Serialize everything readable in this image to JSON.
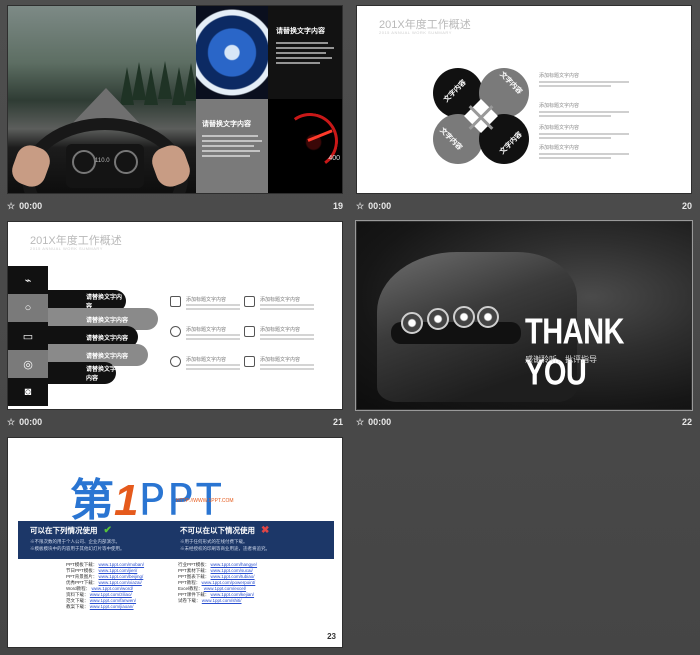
{
  "slides": [
    {
      "number": "19",
      "time": "00:00",
      "panel_top_title": "请替换文字内容",
      "panel_bottom_title": "请替换文字内容",
      "speedometer_value": "400",
      "dash_value": "110.0"
    },
    {
      "number": "20",
      "time": "00:00",
      "title": "201X年度工作概述",
      "subtitle": "2015 ANNUAL WORK SUMMARY",
      "labels": [
        "文字内容",
        "文字内容",
        "文字内容",
        "文字内容"
      ],
      "text_heads": [
        "添加标题文字内容",
        "添加标题文字内容",
        "添加标题文字内容",
        "添加标题文字内容"
      ]
    },
    {
      "number": "21",
      "time": "00:00",
      "title": "201X年度工作概述",
      "subtitle": "2015 ANNUAL WORK SUMMARY",
      "arms": [
        "请替换文字内容",
        "请替换文字内容",
        "请替换文字内容",
        "请替换文字内容",
        "请替换文字内容"
      ],
      "items": [
        "添加标题文字内容",
        "添加标题文字内容",
        "添加标题文字内容",
        "添加标题文字内容",
        "添加标题文字内容",
        "添加标题文字内容"
      ]
    },
    {
      "number": "22",
      "time": "00:00",
      "headline": "THANK YOU",
      "subline": "感谢聆听，批评指导"
    },
    {
      "number": "23",
      "logo_cn": "第",
      "logo_one": "1",
      "logo_ppt": "PPT",
      "logo_url": "HTTP://WWW.1PPT.COM",
      "can_title": "可以在下列情况使用",
      "cannot_title": "不可以在以下情况使用",
      "can_lines": [
        "※不限次数的用于个人公司、企业内部演示。",
        "※模板模块中的内容用于其他幻灯片等中使用。"
      ],
      "cannot_lines": [
        "※用于任何形式的在线付费下载。",
        "※未经授权的印刷等商业用途，违者将追究。"
      ],
      "left_links": [
        {
          "label": "PPT模板下载：",
          "url": "www.1ppt.com/moban/"
        },
        {
          "label": "节日PPT模板：",
          "url": "www.1ppt.com/jieri/"
        },
        {
          "label": "PPT背景图片：",
          "url": "www.1ppt.com/beijing/"
        },
        {
          "label": "优秀PPT下载：",
          "url": "www.1ppt.com/xiazai/"
        },
        {
          "label": "Word教程：",
          "url": "www.1ppt.com/word/"
        },
        {
          "label": "资料下载：",
          "url": "www.1ppt.com/ziliao/"
        },
        {
          "label": "范文下载：",
          "url": "www.1ppt.com/fanwen/"
        },
        {
          "label": "教案下载：",
          "url": "www.1ppt.com/jiaoan/"
        }
      ],
      "right_links": [
        {
          "label": "行业PPT模板：",
          "url": "www.1ppt.com/hangye/"
        },
        {
          "label": "PPT素材下载：",
          "url": "www.1ppt.com/sucai/"
        },
        {
          "label": "PPT图表下载：",
          "url": "www.1ppt.com/tubiao/"
        },
        {
          "label": "PPT教程：",
          "url": "www.1ppt.com/powerpoint/"
        },
        {
          "label": "Excel教程：",
          "url": "www.1ppt.com/excel/"
        },
        {
          "label": "PPT课件下载：",
          "url": "www.1ppt.com/kejian/"
        },
        {
          "label": "试卷下载：",
          "url": "www.1ppt.com/shiti/"
        }
      ]
    }
  ],
  "colors": {
    "banner": "#1c3768",
    "accent_orange": "#e55a1c",
    "accent_blue": "#2a75d2"
  }
}
